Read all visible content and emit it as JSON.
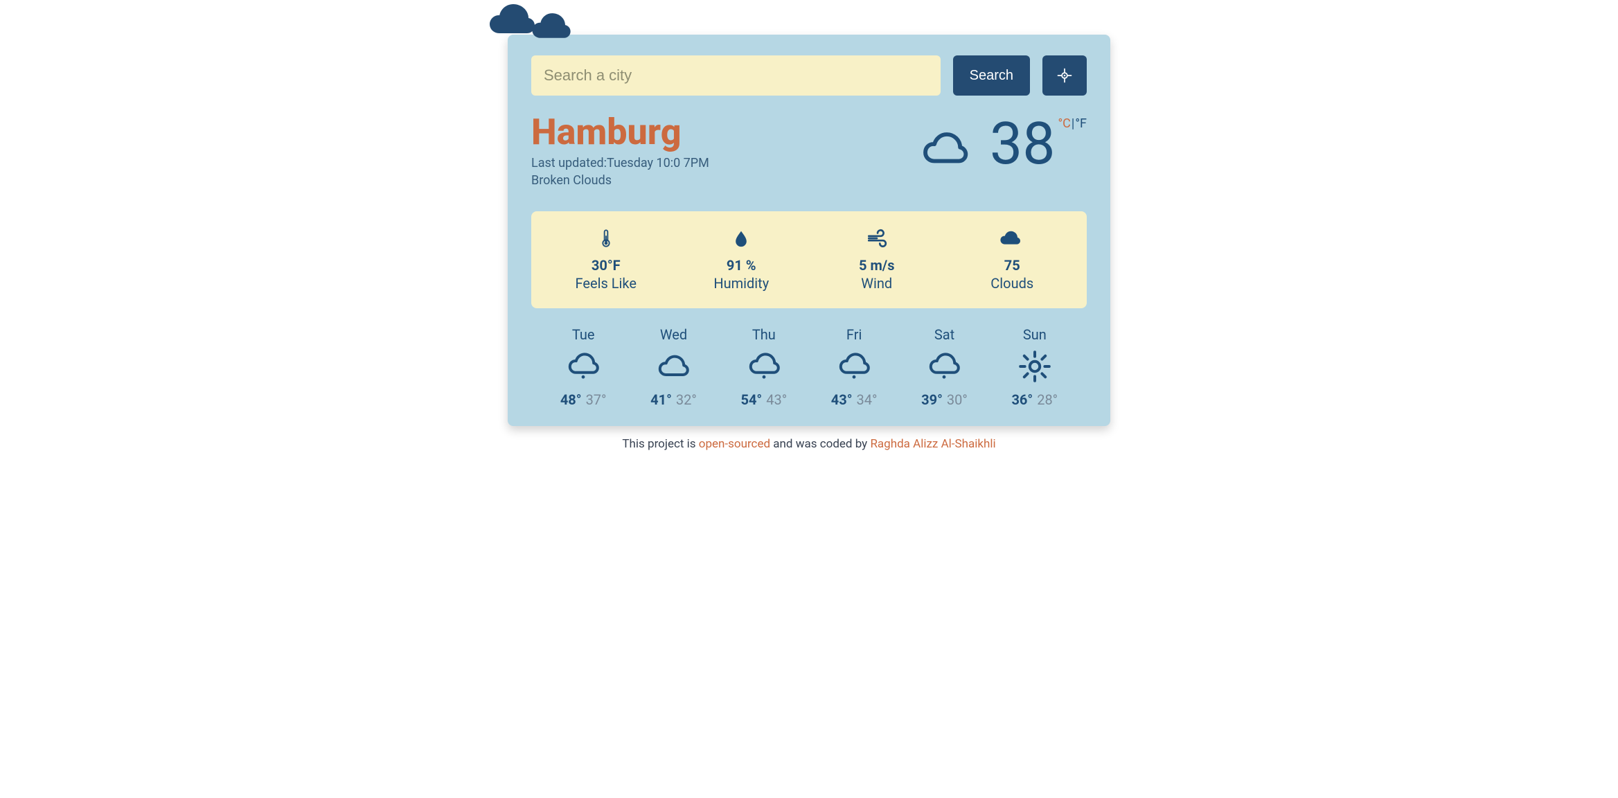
{
  "search": {
    "placeholder": "Search a city",
    "button_label": "Search"
  },
  "header": {
    "city": "Hamburg",
    "last_updated_label": "Last updated:",
    "last_updated_value": "Tuesday 10:0 7PM",
    "description": "Broken Clouds",
    "temperature": "38",
    "unit_c": "°C",
    "unit_f": "°F",
    "active_unit": "C",
    "weather_icon": "cloud"
  },
  "stats": [
    {
      "icon": "thermometer",
      "value": "30°F",
      "label": "Feels Like"
    },
    {
      "icon": "droplet",
      "value": "91 %",
      "label": "Humidity"
    },
    {
      "icon": "wind",
      "value": "5 m/s",
      "label": "Wind"
    },
    {
      "icon": "cloud-solid",
      "value": "75",
      "label": "Clouds"
    }
  ],
  "forecast": [
    {
      "day": "Tue",
      "icon": "cloud-rain",
      "hi": "48°",
      "lo": "37°"
    },
    {
      "day": "Wed",
      "icon": "cloud",
      "hi": "41°",
      "lo": "32°"
    },
    {
      "day": "Thu",
      "icon": "cloud-rain",
      "hi": "54°",
      "lo": "43°"
    },
    {
      "day": "Fri",
      "icon": "cloud-rain",
      "hi": "43°",
      "lo": "34°"
    },
    {
      "day": "Sat",
      "icon": "cloud-rain",
      "hi": "39°",
      "lo": "30°"
    },
    {
      "day": "Sun",
      "icon": "sun",
      "hi": "36°",
      "lo": "28°"
    }
  ],
  "footer": {
    "prefix": "This project is ",
    "link1": "open-sourced",
    "middle": " and was coded by ",
    "link2": "Raghda Alizz Al-Shaikhli"
  }
}
